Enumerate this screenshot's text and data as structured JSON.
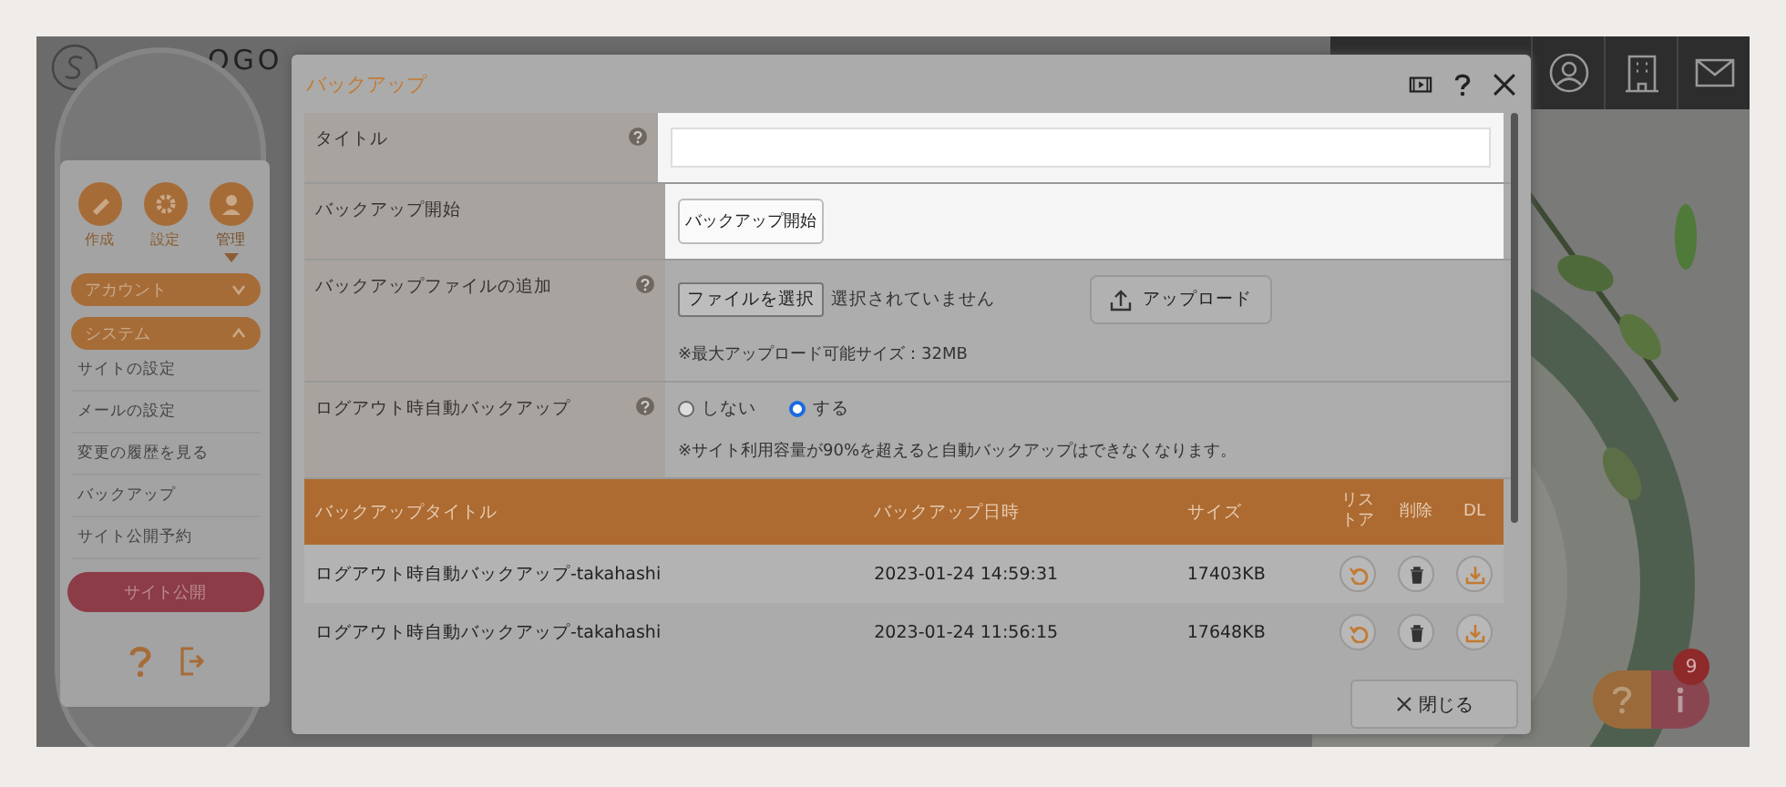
{
  "header": {
    "logo_text": "OGO"
  },
  "sidebar": {
    "top_icons": [
      {
        "label": "作成",
        "selected": false
      },
      {
        "label": "設定",
        "selected": false
      },
      {
        "label": "管理",
        "selected": true
      }
    ],
    "categories": [
      {
        "label": "アカウント",
        "expanded": false
      },
      {
        "label": "システム",
        "expanded": true,
        "items": [
          "サイトの設定",
          "メールの設定",
          "変更の履歴を見る",
          "バックアップ",
          "サイト公開予約"
        ]
      }
    ],
    "publish_button": "サイト公開"
  },
  "dialog": {
    "title": "バックアップ",
    "fields": [
      {
        "kind": "text",
        "label": "タイトル",
        "help": true,
        "highlighted": true
      },
      {
        "kind": "button",
        "label": "バックアップ開始",
        "help": false,
        "highlighted": true,
        "button": "バックアップ開始"
      },
      {
        "kind": "file",
        "label": "バックアップファイルの追加",
        "help": true,
        "highlighted": false,
        "file_button": "ファイルを選択",
        "file_status": "選択されていません",
        "upload_button": "アップロード",
        "note": "※最大アップロード可能サイズ：32MB"
      },
      {
        "kind": "radio",
        "label": "ログアウト時自動バックアップ",
        "help": true,
        "highlighted": false,
        "options": [
          {
            "label": "しない",
            "selected": false
          },
          {
            "label": "する",
            "selected": true
          }
        ],
        "note": "※サイト利用容量が90%を超えると自動バックアップはできなくなります。"
      }
    ],
    "table": {
      "columns": [
        "バックアップタイトル",
        "バックアップ日時",
        "サイズ",
        "リストア",
        "削除",
        "DL"
      ],
      "rows": [
        {
          "title": "ログアウト時自動バックアップ-takahashi",
          "date": "2023-01-24 14:59:31",
          "size": "17403KB"
        },
        {
          "title": "ログアウト時自動バックアップ-takahashi",
          "date": "2023-01-24 11:56:15",
          "size": "17648KB"
        }
      ]
    },
    "close_button": "閉じる"
  },
  "help_widget": {
    "badge": "9"
  }
}
